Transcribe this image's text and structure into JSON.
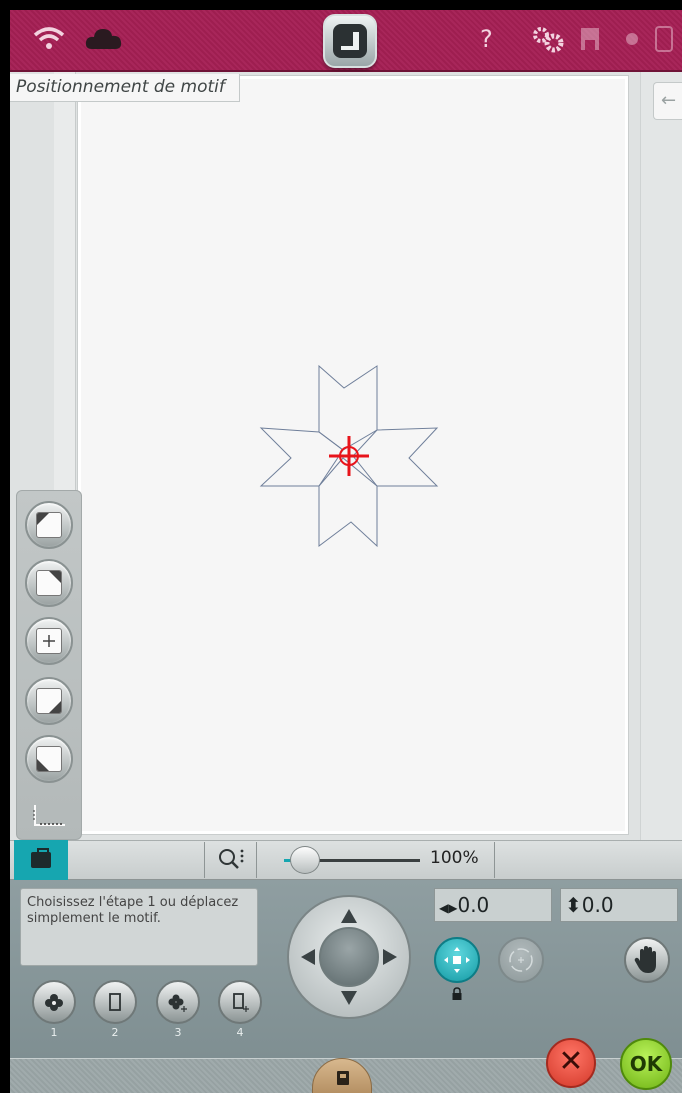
{
  "header": {
    "help_label": "?"
  },
  "page": {
    "title": "Positionnement de motif",
    "collapse_glyph": "←"
  },
  "zoom": {
    "label": "100%",
    "level": 0.06
  },
  "panel": {
    "message": "Choisissez l'étape 1 ou déplacez simplement le motif.",
    "x_value": "0.0",
    "y_value": "0.0",
    "x_glyph": "◀▶",
    "y_glyph": "⬍",
    "steps": [
      {
        "label": "1"
      },
      {
        "label": "2"
      },
      {
        "label": "3"
      },
      {
        "label": "4"
      }
    ]
  },
  "actions": {
    "cancel_glyph": "✕",
    "ok_label": "OK"
  },
  "colors": {
    "brand": "#a8265a",
    "accent": "#16a6b0",
    "ok": "#6fb314",
    "cancel": "#d3392a",
    "crosshair": "#e8141b"
  }
}
